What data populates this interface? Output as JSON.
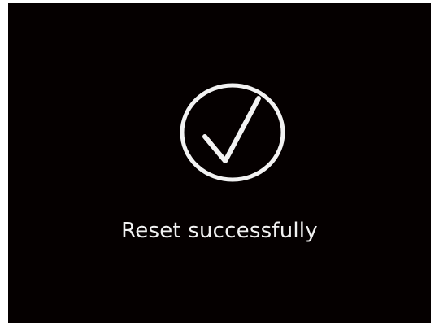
{
  "dialog": {
    "icon": "check-circle-icon",
    "message": "Reset successfully"
  },
  "colors": {
    "background": "#050000",
    "foreground": "#f2f2f2"
  }
}
